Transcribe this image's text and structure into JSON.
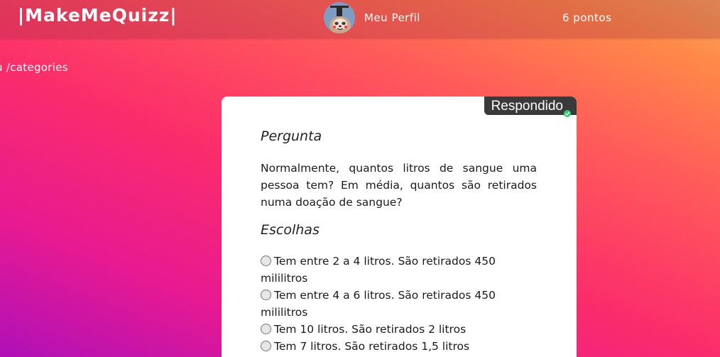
{
  "navbar": {
    "brand": "|MakeMeQuizz|",
    "profile_label": "Meu Perfil",
    "points_label": "6 pontos",
    "avatar_icon": "sloth-avatar-icon"
  },
  "breadcrumb": {
    "text": "u /categories"
  },
  "card": {
    "status_label": "Respondido",
    "status_icon": "check-icon",
    "question_heading": "Pergunta",
    "question_text": "Normalmente, quantos litros de sangue uma pessoa tem? Em média, quantos são retirados numa doação de sangue?",
    "choices_heading": "Escolhas",
    "choices": [
      {
        "label": "Tem entre 2 a 4 litros. São retirados 450 mililitros"
      },
      {
        "label": "Tem entre 4 a 6 litros. São retirados 450 mililitros"
      },
      {
        "label": "Tem 10 litros. São retirados 2 litros"
      },
      {
        "label": "Tem 7 litros. São retirados 1,5 litros"
      }
    ]
  },
  "colors": {
    "badge_bg": "#3a3a3a",
    "check": "#2ecc71",
    "card_bg": "#ffffff"
  }
}
